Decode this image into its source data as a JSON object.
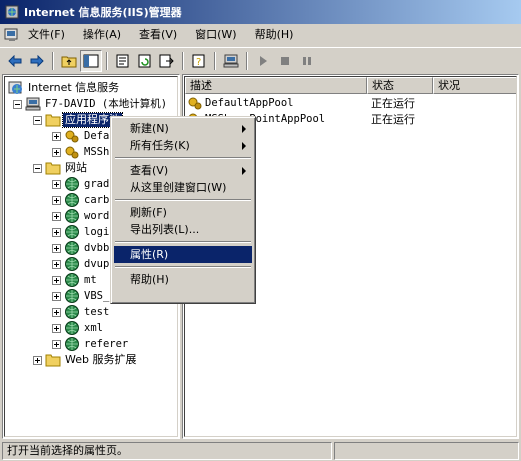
{
  "window": {
    "title": "Internet 信息服务(IIS)管理器"
  },
  "menubar": {
    "items": [
      "文件(F)",
      "操作(A)",
      "查看(V)",
      "窗口(W)",
      "帮助(H)"
    ]
  },
  "toolbar": {
    "buttons": [
      "back-icon",
      "forward-icon",
      "up-folder-icon",
      "show-tree-icon",
      "properties-icon",
      "refresh-icon",
      "export-icon",
      "help-icon",
      "computer-icon",
      "play-icon",
      "stop-icon",
      "pause-icon"
    ]
  },
  "tree": {
    "root": "Internet 信息服务",
    "computer": "F7-DAVID (本地计算机)",
    "app_pools": "应用程序池",
    "app_pool_children": [
      "Defa",
      "MSSh"
    ],
    "websites": "网站",
    "website_children": [
      "grad",
      "carb",
      "word",
      "logi",
      "dvbb",
      "dvup",
      "mt",
      "VBS_",
      "test",
      "xml",
      "referer"
    ],
    "web_ext": "Web 服务扩展"
  },
  "list": {
    "columns": [
      "描述",
      "状态",
      "状况"
    ],
    "rows": [
      {
        "name": "DefaultAppPool",
        "status": "正在运行"
      },
      {
        "name": "MSSharePointAppPool",
        "status": "正在运行"
      }
    ]
  },
  "context_menu": {
    "items": [
      {
        "label": "新建(N)",
        "submenu": true
      },
      {
        "label": "所有任务(K)",
        "submenu": true
      },
      {
        "separator": true
      },
      {
        "label": "查看(V)",
        "submenu": true
      },
      {
        "label": "从这里创建窗口(W)"
      },
      {
        "separator": true
      },
      {
        "label": "刷新(F)"
      },
      {
        "label": "导出列表(L)..."
      },
      {
        "separator": true
      },
      {
        "label": "属性(R)",
        "highlighted": true
      },
      {
        "separator": true
      },
      {
        "label": "帮助(H)"
      }
    ]
  },
  "statusbar": {
    "text": "打开当前选择的属性页。"
  },
  "colors": {
    "titlebar_start": "#0a246a",
    "titlebar_end": "#a6caf0",
    "selection": "#0a246a",
    "chrome": "#d4d0c8"
  }
}
